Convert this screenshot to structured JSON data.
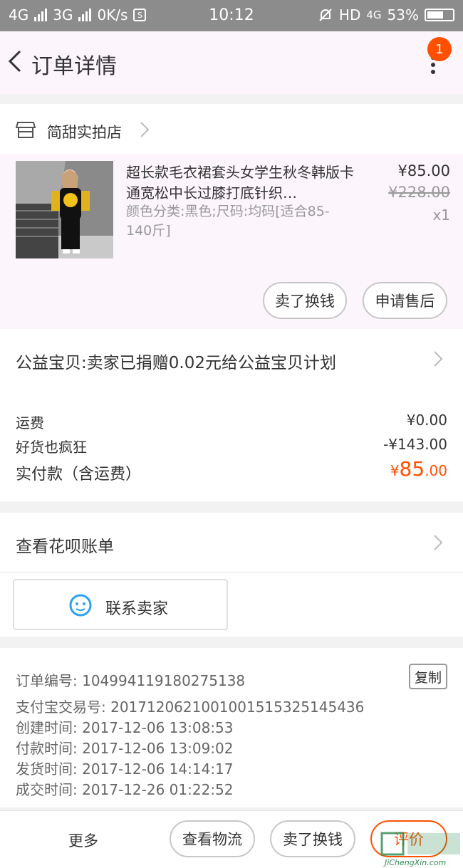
{
  "status_bar": {
    "left": [
      "4G",
      "3G",
      "0K/s"
    ],
    "time": "10:12",
    "right_network": "HD",
    "right_4g": "4G",
    "battery": "53%"
  },
  "header": {
    "title": "订单详情",
    "badge_count": "1"
  },
  "shop": {
    "name": "简甜实拍店"
  },
  "product": {
    "title": "超长款毛衣裙套头女学生秋冬韩版卡通宽松中长过膝打底针织…",
    "sku": "颜色分类:黑色;尺码:均码[适合85-140斤]",
    "price": "¥85.00",
    "original_price": "¥228.00",
    "quantity": "x1"
  },
  "item_actions": {
    "resell": "卖了换钱",
    "after_sale": "申请售后"
  },
  "donation": "公益宝贝:卖家已捐赠0.02元给公益宝贝计划",
  "fees": {
    "shipping_label": "运费",
    "shipping_value": "¥0.00",
    "discount_label": "好货也疯狂",
    "discount_value": "-¥143.00",
    "paid_label": "实付款（含运费）",
    "paid_currency": "¥",
    "paid_int": "85",
    "paid_dec": ".00"
  },
  "huabei": "查看花呗账单",
  "contact_seller": "联系卖家",
  "order_info": {
    "order_no": "订单编号: 104994119180275138",
    "copy": "复制",
    "alipay_no": "支付宝交易号: 2017120621001001515325145436",
    "created": "创建时间: 2017-12-06 13:08:53",
    "paid": "付款时间: 2017-12-06 13:09:02",
    "shipped": "发货时间: 2017-12-06 14:14:17",
    "completed": "成交时间: 2017-12-26 01:22:52"
  },
  "bottom_bar": {
    "more": "更多",
    "logistics": "查看物流",
    "resell": "卖了换钱",
    "rate": "评价"
  },
  "watermark": "JiChengXin.com",
  "colors": {
    "accent": "#ff5000",
    "header_bg": "#fcf5fc",
    "status_bg": "#8c8c8c",
    "contact_icon": "#2ea1f2"
  }
}
